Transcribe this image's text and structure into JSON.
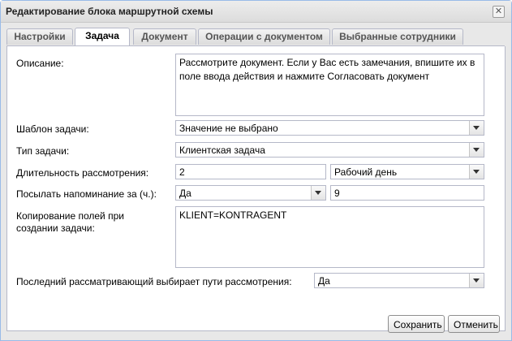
{
  "window": {
    "title": "Редактирование блока маршрутной схемы"
  },
  "tabs": [
    {
      "label": "Настройки",
      "active": false
    },
    {
      "label": "Задача",
      "active": true
    },
    {
      "label": "Документ",
      "active": false
    },
    {
      "label": "Операции с документом",
      "active": false
    },
    {
      "label": "Выбранные сотрудники",
      "active": false
    }
  ],
  "form": {
    "description_label": "Описание:",
    "description_value": "Рассмотрите документ. Если у Вас есть замечания, впишите их в поле ввода действия и нажмите Согласовать документ",
    "template_label": "Шаблон задачи:",
    "template_value": "Значение не выбрано",
    "type_label": "Тип задачи:",
    "type_value": "Клиентская задача",
    "duration_label": "Длительность рассмотрения:",
    "duration_value": "2",
    "duration_unit": "Рабочий день",
    "reminder_label": "Посылать напоминание за (ч.):",
    "reminder_value": "Да",
    "reminder_hours": "9",
    "copy_fields_label": "Копирование полей при создании задачи:",
    "copy_fields_value": "KLIENT=KONTRAGENT",
    "last_reviewer_label": "Последний рассматривающий выбирает пути рассмотрения:",
    "last_reviewer_value": "Да"
  },
  "footer": {
    "save_label": "Сохранить",
    "cancel_label": "Отменить"
  },
  "icons": {
    "close": "close-icon",
    "dropdown": "chevron-down-icon"
  }
}
